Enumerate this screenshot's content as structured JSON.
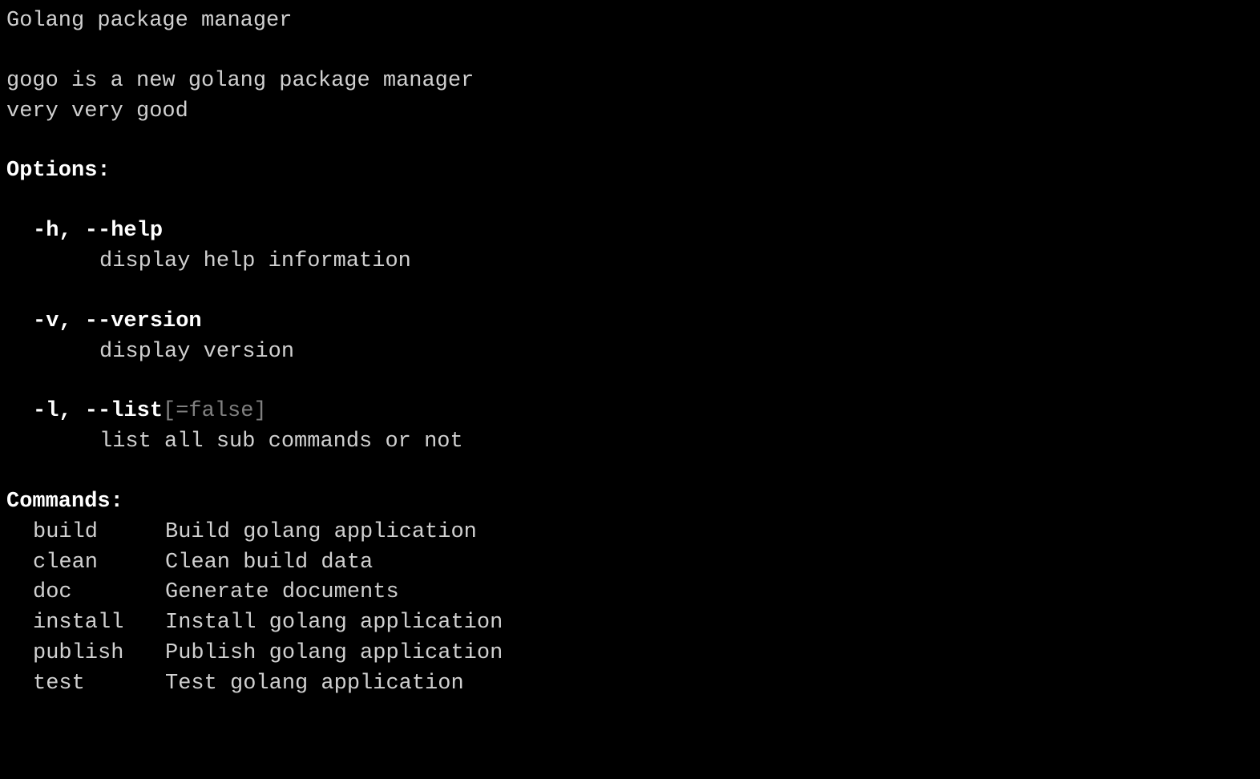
{
  "title": "Golang package manager",
  "description_line1": "gogo is a new golang package manager",
  "description_line2": "very very good",
  "options_header": "Options:",
  "options": [
    {
      "flags": "-h, --help",
      "default": "",
      "desc": "display help information"
    },
    {
      "flags": "-v, --version",
      "default": "",
      "desc": "display version"
    },
    {
      "flags": "-l, --list",
      "default": "[=false]",
      "desc": "list all sub commands or not"
    }
  ],
  "commands_header": "Commands:",
  "commands": [
    {
      "name": "build",
      "desc": "Build golang application"
    },
    {
      "name": "clean",
      "desc": "Clean build data"
    },
    {
      "name": "doc",
      "desc": "Generate documents"
    },
    {
      "name": "install",
      "desc": "Install golang application"
    },
    {
      "name": "publish",
      "desc": "Publish golang application"
    },
    {
      "name": "test",
      "desc": "Test golang application"
    }
  ]
}
